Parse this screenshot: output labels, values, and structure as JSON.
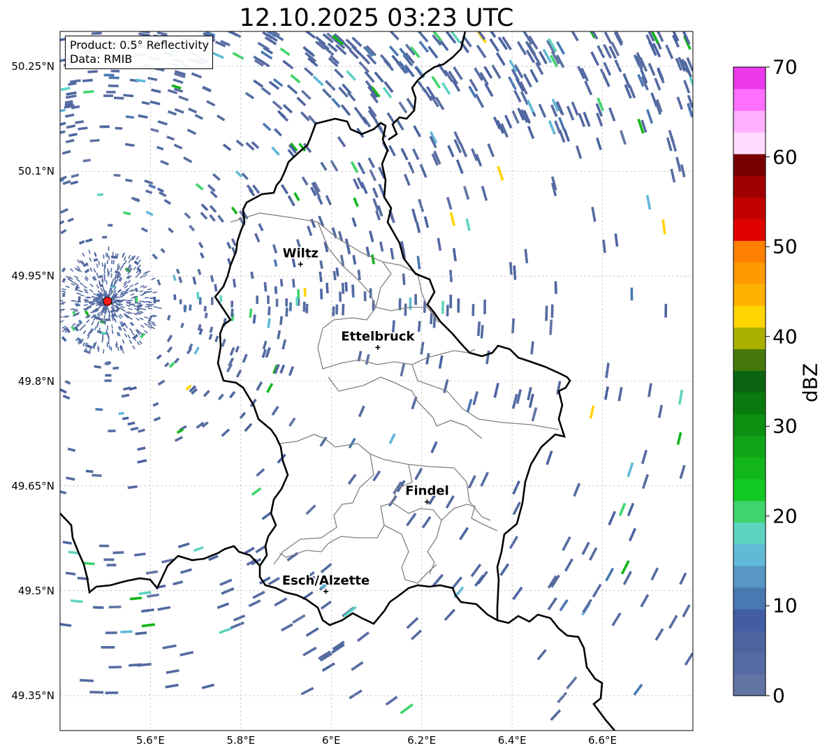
{
  "title": "12.10.2025 03:23 UTC",
  "info_box": {
    "product": "Product: 0.5° Reflectivity",
    "data": "Data: RMIB"
  },
  "map": {
    "lon_range": [
      5.4,
      6.8
    ],
    "lat_range": [
      49.3,
      50.3
    ],
    "gridlines": true,
    "lat_ticks": [
      {
        "value": 50.25,
        "label": "50.25°N"
      },
      {
        "value": 50.1,
        "label": "50.1°N"
      },
      {
        "value": 49.95,
        "label": "49.95°N"
      },
      {
        "value": 49.8,
        "label": "49.8°N"
      },
      {
        "value": 49.65,
        "label": "49.65°N"
      },
      {
        "value": 49.5,
        "label": "49.5°N"
      },
      {
        "value": 49.35,
        "label": "49.35°N"
      }
    ],
    "lon_ticks": [
      {
        "value": 5.6,
        "label": "5.6°E"
      },
      {
        "value": 5.8,
        "label": "5.8°E"
      },
      {
        "value": 6.0,
        "label": "6°E"
      },
      {
        "value": 6.2,
        "label": "6.2°E"
      },
      {
        "value": 6.4,
        "label": "6.4°E"
      },
      {
        "value": 6.6,
        "label": "6.6°E"
      }
    ],
    "radar_site": {
      "lon": 5.505,
      "lat": 49.914,
      "color": "#ff1a1a"
    },
    "cities": [
      {
        "name": "Wiltz",
        "lon": 5.932,
        "lat": 49.967
      },
      {
        "name": "Ettelbruck",
        "lon": 6.103,
        "lat": 49.848
      },
      {
        "name": "Findel",
        "lon": 6.212,
        "lat": 49.627
      },
      {
        "name": "Esch/Alzette",
        "lon": 5.988,
        "lat": 49.499
      }
    ],
    "border_color": "#000000",
    "canton_color": "#808080"
  },
  "colorbar": {
    "label": "dBZ",
    "min": 0,
    "max": 70,
    "ticks": [
      0,
      10,
      20,
      30,
      40,
      50,
      60,
      70
    ],
    "colors": [
      "#6274a4",
      "#566ba1",
      "#4c65a0",
      "#425da2",
      "#4a78b1",
      "#5796c5",
      "#62b9d7",
      "#5ed4c0",
      "#3fd46c",
      "#12c822",
      "#12b51a",
      "#10a518",
      "#0d8f12",
      "#0b7a0e",
      "#0a6410",
      "#46780e",
      "#aab000",
      "#ffd400",
      "#ffb100",
      "#ff9a00",
      "#ff7f00",
      "#e00000",
      "#c20000",
      "#a00000",
      "#780000",
      "#ffdcff",
      "#ffb1ff",
      "#ff70ff",
      "#ea38ea"
    ]
  }
}
